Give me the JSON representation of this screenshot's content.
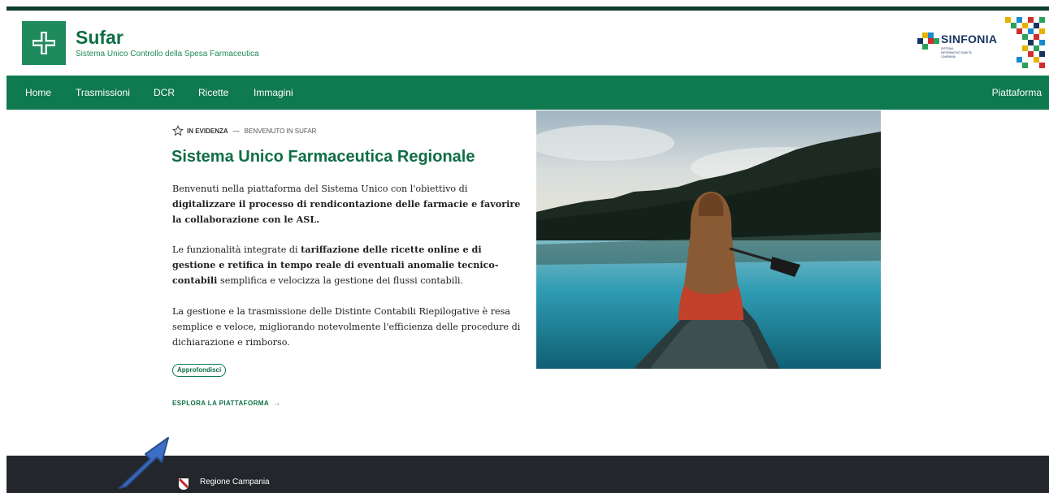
{
  "header": {
    "brand_title": "Sufar",
    "brand_subtitle": "Sistema Unico Controllo della Spesa Farmaceutica",
    "partner_logo": "SINFONIA",
    "partner_small": "SISTEMA INFORMATIVO SANITÀ CAMPANIA"
  },
  "nav": {
    "items": [
      "Home",
      "Trasmissioni",
      "DCR",
      "Ricette",
      "Immagini"
    ],
    "right": "Piattaforma"
  },
  "main": {
    "kicker_strong": "IN EVIDENZA",
    "kicker_sep": "—",
    "kicker_text": "BENVENUTO IN SUFAR",
    "title": "Sistema Unico Farmaceutica Regionale",
    "p1_a": "Benvenuti nella piattaforma del Sistema Unico con l'obiettivo di ",
    "p1_b": "digitalizzare il processo di rendicontazione delle farmacie e favorire la collaborazione con le ASL.",
    "p2_a": "Le funzionalità integrate di ",
    "p2_b": "tariffazione delle ricette online e di gestione e retifica in tempo reale di eventuali anomalie tecnico-contabili",
    "p2_c": " semplifica e velocizza la gestione dei flussi contabili.",
    "p3": "La gestione e la trasmissione delle Distinte Contabili Riepilogative è resa semplice e veloce, migliorando notevolmente l'efficienza delle procedure di dichiarazione e rimborso.",
    "pill": "Approfondisci",
    "explore": "ESPLORA LA PIATTAFORMA",
    "explore_arrow": "→"
  },
  "footer": {
    "label": "Regione Campania"
  },
  "colors": {
    "brand_green": "#0f7a4f",
    "dark_green": "#0f6e46",
    "footer_bg": "#23262b",
    "annotation_blue": "#3d6fc4"
  },
  "icons": {
    "logo": "pharmacy-cross-icon",
    "kicker": "star-icon",
    "annotation": "annotation-arrow-icon"
  }
}
